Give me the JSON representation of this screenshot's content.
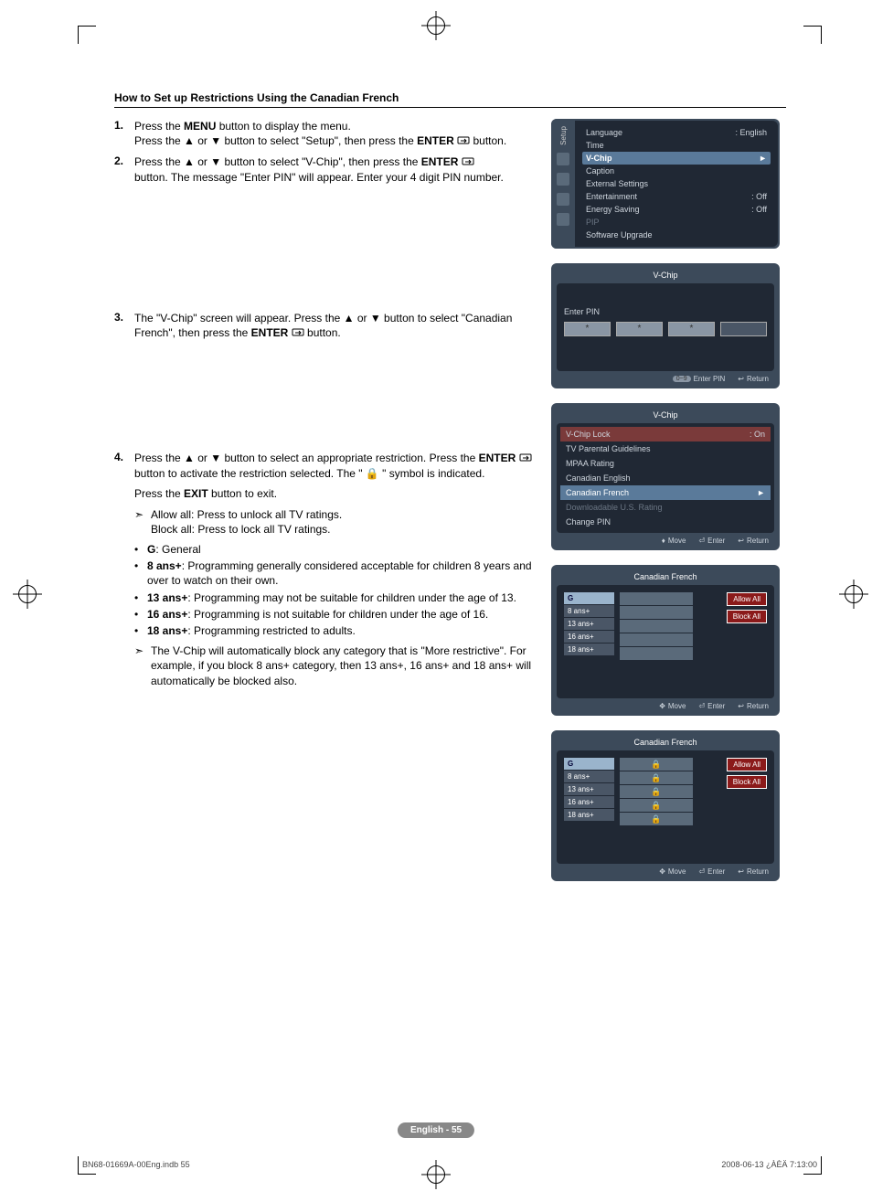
{
  "section_title": "How to Set up Restrictions Using the Canadian French",
  "steps": {
    "s1": {
      "num": "1.",
      "l1a": "Press the ",
      "l1b": "MENU",
      "l1c": " button to display the menu.",
      "l2a": "Press the ▲ or ▼ button to select \"Setup\", then press the ",
      "l2b": "ENTER",
      "l2c": " button."
    },
    "s2": {
      "num": "2.",
      "l1a": "Press the ▲ or ▼ button to select \"V-Chip\", then press the ",
      "l1b": "ENTER",
      "l2": "button. The message \"Enter PIN\" will appear. Enter your 4 digit PIN number."
    },
    "s3": {
      "num": "3.",
      "l1": "The \"V-Chip\" screen will appear. Press the ▲ or ▼ button to select \"Canadian French\", then press the ",
      "l2": "ENTER",
      "l3": " button."
    },
    "s4": {
      "num": "4.",
      "p1a": "Press the ▲ or ▼ button to select an appropriate restriction. Press the ",
      "p1b": "ENTER",
      "p1c": " button to activate the restriction selected. The \" ",
      "p1d": " \" symbol is indicated.",
      "p2a": "Press the ",
      "p2b": "EXIT",
      "p2c": " button to exit.",
      "allow": "Allow all: Press to unlock all TV ratings.",
      "block": "Block all: Press to lock all TV ratings.",
      "g_a": "G",
      "g_b": ": General",
      "a8_a": "8 ans+",
      "a8_b": ": Programming generally considered acceptable for children 8 years and over to watch on their own.",
      "a13_a": "13 ans+",
      "a13_b": ": Programming may not be suitable for children under the age of 13.",
      "a16_a": "16 ans+",
      "a16_b": ": Programming is not suitable for children under the age of 16.",
      "a18_a": "18 ans+",
      "a18_b": ": Programming restricted to adults.",
      "note": "The V-Chip will automatically block any category that is \"More restrictive\". For example, if you block 8 ans+ category, then 13 ans+, 16 ans+ and 18 ans+ will automatically be blocked also."
    }
  },
  "osd_setup": {
    "side_label": "Setup",
    "language": "Language",
    "language_val": ": English",
    "time": "Time",
    "vchip": "V-Chip",
    "caption": "Caption",
    "external": "External Settings",
    "entertainment": "Entertainment",
    "ent_val": ": Off",
    "energy": "Energy Saving",
    "energy_val": ": Off",
    "pip": "PIP",
    "software": "Software Upgrade",
    "arrow": "►"
  },
  "osd_pin": {
    "title": "V-Chip",
    "enter": "Enter PIN",
    "star": "*",
    "foot_pill": "0~9",
    "foot_enter": "Enter PIN",
    "foot_return": "Return"
  },
  "osd_vchip": {
    "title": "V-Chip",
    "lock": "V-Chip Lock",
    "lock_val": ": On",
    "tvpg": "TV Parental Guidelines",
    "mpaa": "MPAA Rating",
    "ce": "Canadian English",
    "cf": "Canadian French",
    "dl": "Downloadable U.S. Rating",
    "chpin": "Change PIN",
    "arrow": "►",
    "move": "Move",
    "enter": "Enter",
    "ret": "Return"
  },
  "osd_cf": {
    "title": "Canadian French",
    "g": "G",
    "a8": "8 ans+",
    "a13": "13 ans+",
    "a16": "16 ans+",
    "a18": "18 ans+",
    "allow": "Allow All",
    "block": "Block All",
    "move": "Move",
    "enter": "Enter",
    "ret": "Return"
  },
  "footer": {
    "page": "English - 55",
    "doc_left": "BN68-01669A-00Eng.indb   55",
    "doc_right": "2008-06-13   ¿ÀÈÄ 7:13:00"
  }
}
